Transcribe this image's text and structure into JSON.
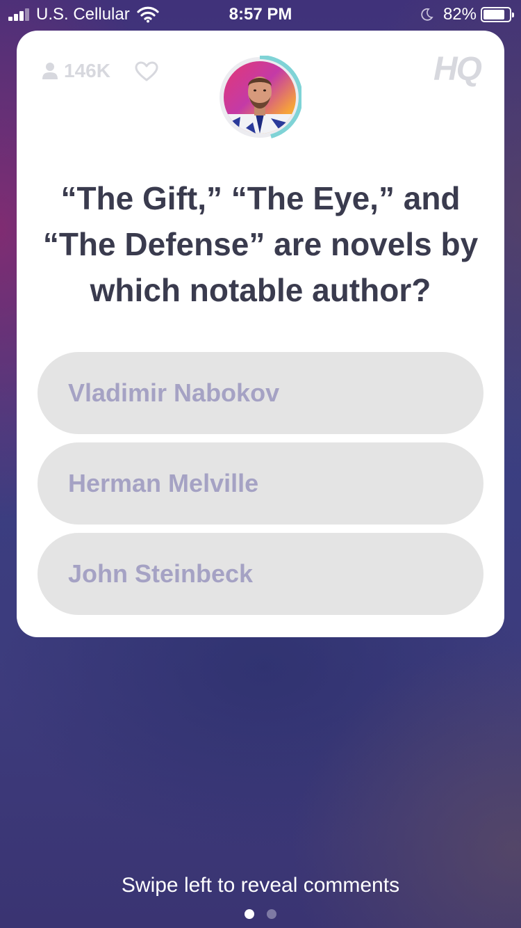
{
  "status_bar": {
    "carrier": "U.S. Cellular",
    "time": "8:57 PM",
    "battery_percent": "82%",
    "battery_level": 0.82,
    "icons": [
      "signal-icon",
      "wifi-icon",
      "moon-icon",
      "battery-icon"
    ]
  },
  "game": {
    "viewer_count": "146K",
    "logo": "HQ",
    "question": "“The Gift,” “The Eye,” and “The Defense” are novels by which notable author?",
    "answers": [
      {
        "label": "Vladimir Nabokov"
      },
      {
        "label": "Herman Melville"
      },
      {
        "label": "John Steinbeck"
      }
    ],
    "icons": [
      "person-icon",
      "heart-icon",
      "host-avatar"
    ]
  },
  "footer": {
    "swipe_hint": "Swipe left to reveal comments",
    "page_count": 2,
    "active_page": 1
  },
  "colors": {
    "card_bg": "#ffffff",
    "question_text": "#3a3b4e",
    "answer_bg": "#e4e4e4",
    "answer_text": "#a5a2c4",
    "muted_icon": "#d7d8de",
    "timer_ring": "#7fd3d6"
  }
}
